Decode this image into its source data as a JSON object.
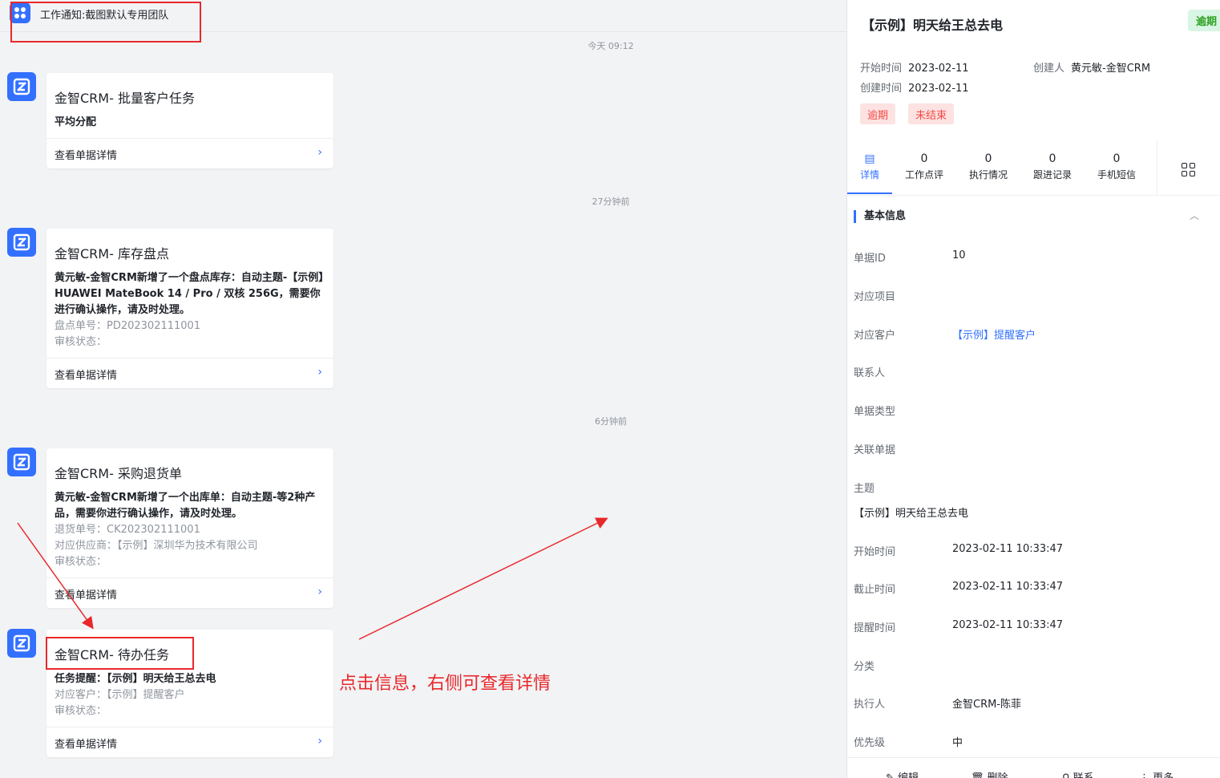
{
  "header": {
    "title": "工作通知:截图默认专用团队"
  },
  "time_separators": [
    "今天 09:12",
    "27分钟前",
    "6分钟前"
  ],
  "messages": [
    {
      "title": "金智CRM- 批量客户任务",
      "lines": [
        {
          "text": "平均分配",
          "style": "bold"
        }
      ],
      "footer": "查看单据详情"
    },
    {
      "title": "金智CRM- 库存盘点",
      "lines": [
        {
          "text": "黄元敏-金智CRM新增了一个盘点库存：自动主题-【示例】HUAWEI MateBook 14 / Pro / 双核 256G，需要你进行确认操作，请及时处理。",
          "style": "bold"
        },
        {
          "text": "盘点单号：PD202302111001",
          "style": "muted"
        },
        {
          "text": "审核状态：",
          "style": "muted"
        }
      ],
      "footer": "查看单据详情"
    },
    {
      "title": "金智CRM- 采购退货单",
      "lines": [
        {
          "text": "黄元敏-金智CRM新增了一个出库单：自动主题-等2种产品，需要你进行确认操作，请及时处理。",
          "style": "bold"
        },
        {
          "text": "退货单号：CK202302111001",
          "style": "muted"
        },
        {
          "text": "对应供应商：【示例】深圳华为技术有限公司",
          "style": "muted"
        },
        {
          "text": "审核状态：",
          "style": "muted"
        }
      ],
      "footer": "查看单据详情"
    },
    {
      "title": "金智CRM- 待办任务",
      "lines": [
        {
          "text": "任务提醒：【示例】明天给王总去电",
          "style": "bold"
        },
        {
          "text": "对应客户：【示例】提醒客户",
          "style": "muted"
        },
        {
          "text": "审核状态：",
          "style": "muted"
        }
      ],
      "footer": "查看单据详情"
    }
  ],
  "annotation": {
    "text": "点击信息，右侧可查看详情",
    "color": "#e8282b"
  },
  "panel": {
    "title": "【示例】明天给王总去电",
    "status_corner": "逾期",
    "start_label": "开始时间",
    "start_value": "2023-02-11",
    "created_label": "创建时间",
    "created_value": "2023-02-11",
    "creator_label": "创建人",
    "creator_value": "黄元敏-金智CRM",
    "tags": [
      "逾期",
      "未结束"
    ],
    "tabs": [
      {
        "label": "详情",
        "num": ""
      },
      {
        "label": "工作点评",
        "num": "0"
      },
      {
        "label": "执行情况",
        "num": "0"
      },
      {
        "label": "跟进记录",
        "num": "0"
      },
      {
        "label": "手机短信",
        "num": "0"
      }
    ],
    "section_title": "基本信息",
    "fields": [
      {
        "label": "单据ID",
        "value": "10"
      },
      {
        "label": "对应项目",
        "value": ""
      },
      {
        "label": "对应客户",
        "value": "【示例】提醒客户"
      },
      {
        "label": "联系人",
        "value": ""
      },
      {
        "label": "单据类型",
        "value": ""
      },
      {
        "label": "关联单据",
        "value": ""
      },
      {
        "label": "主题",
        "value": "【示例】明天给王总去电"
      },
      {
        "label": "开始时间",
        "value": "2023-02-11 10:33:47"
      },
      {
        "label": "截止时间",
        "value": "2023-02-11 10:33:47"
      },
      {
        "label": "提醒时间",
        "value": "2023-02-11 10:33:47"
      },
      {
        "label": "分类",
        "value": ""
      },
      {
        "label": "执行人",
        "value": "金智CRM-陈菲"
      },
      {
        "label": "优先级",
        "value": "中"
      }
    ],
    "footer_buttons": [
      "编辑",
      "删除",
      "联系",
      "更多"
    ]
  },
  "colors": {
    "accent": "#3370ff",
    "danger": "#f54a45",
    "annotation": "#e8282b"
  }
}
